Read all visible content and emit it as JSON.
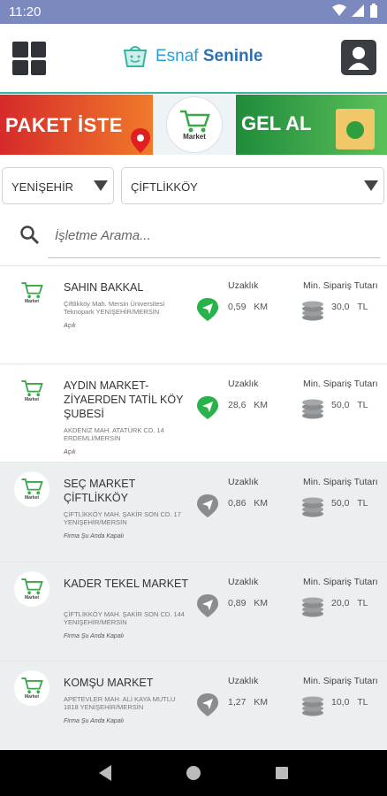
{
  "status": {
    "time": "11:20"
  },
  "header": {
    "logo_left": "Esnaf ",
    "logo_right": "Seninle"
  },
  "banner": {
    "left_text": "PAKET İSTE",
    "mid_label": "Market",
    "right_text": "GEL AL"
  },
  "filters": {
    "district": "YENİŞEHİR",
    "neighborhood": "ÇİFTLİKKÖY"
  },
  "search": {
    "placeholder": "İşletme Arama..."
  },
  "labels": {
    "distance": "Uzaklık",
    "min_order": "Min. Sipariş Tutarı"
  },
  "shops": [
    {
      "name": "SAHIN BAKKAL",
      "address": "Çiftlikköy Mah. Mersin Üniversitesi Teknopark YENİŞEHİR/MERSİN",
      "status": "Açık",
      "distance": "0,59",
      "distance_unit": "KM",
      "min_order": "30,0",
      "currency": "TL",
      "open": true,
      "thumb_label": "Market"
    },
    {
      "name": "AYDIN MARKET-ZİYAERDEN TATİL KÖY ŞUBESİ",
      "address": "AKDENİZ MAH. ATATÜRK CD. 14 ERDEMLİ/MERSİN",
      "status": "Açık",
      "distance": "28,6",
      "distance_unit": "KM",
      "min_order": "50,0",
      "currency": "TL",
      "open": true,
      "thumb_label": "Market"
    },
    {
      "name": "SEÇ MARKET ÇİFTLİKKÖY",
      "address": "ÇİFTLİKKÖY MAH. ŞAKİR SON CD. 17 YENİŞEHİR/MERSİN",
      "status": "Firma Şu Anda Kapalı",
      "distance": "0,86",
      "distance_unit": "KM",
      "min_order": "50,0",
      "currency": "TL",
      "open": false,
      "thumb_label": "Market"
    },
    {
      "name": "KADER TEKEL MARKET",
      "address": "ÇİFTLİKKÖY MAH. ŞAKİR SON CD. 144 YENİŞEHİR/MERSİN",
      "status": "Firma Şu Anda Kapalı",
      "distance": "0,89",
      "distance_unit": "KM",
      "min_order": "20,0",
      "currency": "TL",
      "open": false,
      "thumb_label": "Market"
    },
    {
      "name": "KOMŞU MARKET",
      "address": "APETEVLER MAH. ALİ KAYA MUTLU 1818 YENİŞEHİR/MERSİN",
      "status": "Firma Şu Anda Kapalı",
      "distance": "1,27",
      "distance_unit": "KM",
      "min_order": "10,0",
      "currency": "TL",
      "open": false,
      "thumb_label": "Market"
    }
  ],
  "colors": {
    "open_pin": "#27b24a",
    "closed_pin": "#8a8d90",
    "accent": "#36b5a0"
  }
}
